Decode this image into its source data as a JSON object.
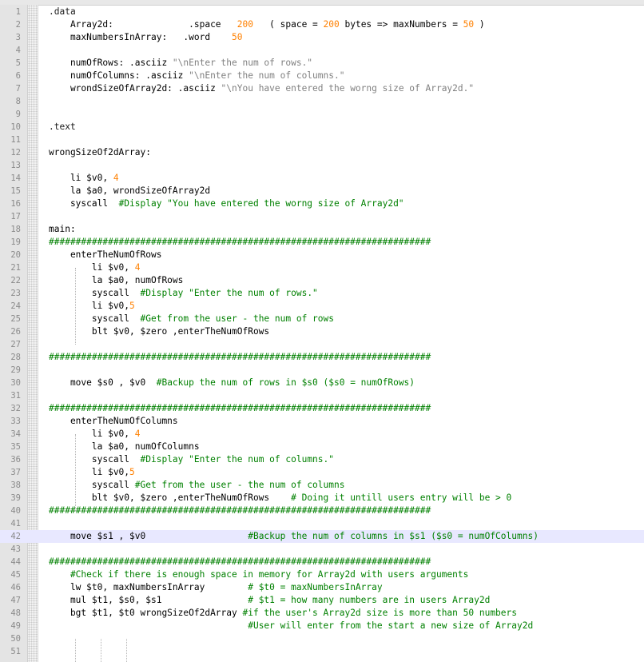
{
  "editor": {
    "line_numbers": [
      "1",
      "2",
      "3",
      "4",
      "5",
      "6",
      "7",
      "8",
      "9",
      "10",
      "11",
      "12",
      "13",
      "14",
      "15",
      "16",
      "17",
      "18",
      "19",
      "20",
      "21",
      "22",
      "23",
      "24",
      "25",
      "26",
      "27",
      "28",
      "29",
      "30",
      "31",
      "32",
      "33",
      "34",
      "35",
      "36",
      "37",
      "38",
      "39",
      "40",
      "41",
      "42",
      "43",
      "44",
      "45",
      "46",
      "47",
      "48",
      "49",
      "50",
      "51"
    ],
    "current_line": 42,
    "lines": [
      [
        {
          "t": ".data",
          "c": "dir"
        }
      ],
      [
        {
          "t": "    Array2d:              .space   ",
          "c": "kw"
        },
        {
          "t": "200",
          "c": "num"
        },
        {
          "t": "   ( space = ",
          "c": "kw"
        },
        {
          "t": "200",
          "c": "num"
        },
        {
          "t": " bytes => maxNumbers = ",
          "c": "kw"
        },
        {
          "t": "50",
          "c": "num"
        },
        {
          "t": " )",
          "c": "kw"
        }
      ],
      [
        {
          "t": "    maxNumbersInArray:   .word    ",
          "c": "kw"
        },
        {
          "t": "50",
          "c": "num"
        }
      ],
      [],
      [
        {
          "t": "    numOfRows: .asciiz ",
          "c": "kw"
        },
        {
          "t": "\"\\nEnter the num of rows.\"",
          "c": "str"
        }
      ],
      [
        {
          "t": "    numOfColumns: .asciiz ",
          "c": "kw"
        },
        {
          "t": "\"\\nEnter the num of columns.\"",
          "c": "str"
        }
      ],
      [
        {
          "t": "    wrondSizeOfArray2d: .asciiz ",
          "c": "kw"
        },
        {
          "t": "\"\\nYou have entered the worng size of Array2d.\"",
          "c": "str"
        }
      ],
      [],
      [],
      [
        {
          "t": ".text",
          "c": "dir"
        }
      ],
      [],
      [
        {
          "t": "wrongSizeOf2dArray:",
          "c": "kw"
        }
      ],
      [],
      [
        {
          "t": "    li $v0, ",
          "c": "kw"
        },
        {
          "t": "4",
          "c": "num"
        }
      ],
      [
        {
          "t": "    la $a0, wrondSizeOfArray2d",
          "c": "kw"
        }
      ],
      [
        {
          "t": "    syscall  ",
          "c": "kw"
        },
        {
          "t": "#Display \"You have entered the worng size of Array2d\"",
          "c": "com"
        }
      ],
      [],
      [
        {
          "t": "main:",
          "c": "kw"
        }
      ],
      [
        {
          "t": "#######################################################################",
          "c": "com"
        }
      ],
      [
        {
          "t": "    enterTheNumOfRows",
          "c": "kw"
        }
      ],
      [
        {
          "t": "        li $v0, ",
          "c": "kw"
        },
        {
          "t": "4",
          "c": "num"
        }
      ],
      [
        {
          "t": "        la $a0, numOfRows",
          "c": "kw"
        }
      ],
      [
        {
          "t": "        syscall  ",
          "c": "kw"
        },
        {
          "t": "#Display \"Enter the num of rows.\"",
          "c": "com"
        }
      ],
      [
        {
          "t": "        li $v0,",
          "c": "kw"
        },
        {
          "t": "5",
          "c": "num"
        }
      ],
      [
        {
          "t": "        syscall  ",
          "c": "kw"
        },
        {
          "t": "#Get from the user - the num of rows",
          "c": "com"
        }
      ],
      [
        {
          "t": "        blt $v0, $zero ,enterTheNumOfRows",
          "c": "kw"
        }
      ],
      [],
      [
        {
          "t": "#######################################################################",
          "c": "com"
        }
      ],
      [],
      [
        {
          "t": "    move $s0 , $v0  ",
          "c": "kw"
        },
        {
          "t": "#Backup the num of rows in $s0 ($s0 = numOfRows)",
          "c": "com"
        }
      ],
      [],
      [
        {
          "t": "#######################################################################",
          "c": "com"
        }
      ],
      [
        {
          "t": "    enterTheNumOfColumns",
          "c": "kw"
        }
      ],
      [
        {
          "t": "        li $v0, ",
          "c": "kw"
        },
        {
          "t": "4",
          "c": "num"
        }
      ],
      [
        {
          "t": "        la $a0, numOfColumns",
          "c": "kw"
        }
      ],
      [
        {
          "t": "        syscall  ",
          "c": "kw"
        },
        {
          "t": "#Display \"Enter the num of columns.\"",
          "c": "com"
        }
      ],
      [
        {
          "t": "        li $v0,",
          "c": "kw"
        },
        {
          "t": "5",
          "c": "num"
        }
      ],
      [
        {
          "t": "        syscall ",
          "c": "kw"
        },
        {
          "t": "#Get from the user - the num of columns",
          "c": "com"
        }
      ],
      [
        {
          "t": "        blt $v0, $zero ,enterTheNumOfRows    ",
          "c": "kw"
        },
        {
          "t": "# Doing it untill users entry will be > 0",
          "c": "com"
        }
      ],
      [
        {
          "t": "#######################################################################",
          "c": "com"
        }
      ],
      [],
      [
        {
          "t": "    move $s1 , $v0                   ",
          "c": "kw"
        },
        {
          "t": "#Backup the num of columns in $s1 ($s0 = numOfColumns)",
          "c": "com"
        }
      ],
      [],
      [
        {
          "t": "#######################################################################",
          "c": "com"
        }
      ],
      [
        {
          "t": "    #Check if there is enough space in memory for Array2d with users arguments",
          "c": "com"
        }
      ],
      [
        {
          "t": "    lw $t0, maxNumbersInArray        ",
          "c": "kw"
        },
        {
          "t": "# $t0 = maxNumbersInArray",
          "c": "com"
        }
      ],
      [
        {
          "t": "    mul $t1, $s0, $s1                ",
          "c": "kw"
        },
        {
          "t": "# $t1 = how many numbers are in users Array2d",
          "c": "com"
        }
      ],
      [
        {
          "t": "    bgt $t1, $t0 wrongSizeOf2dArray ",
          "c": "kw"
        },
        {
          "t": "#if the user's Array2d size is more than 50 numbers",
          "c": "com"
        }
      ],
      [
        {
          "t": "                                     ",
          "c": "kw"
        },
        {
          "t": "#User will enter from the start a new size of Array2d",
          "c": "com"
        }
      ],
      [],
      []
    ]
  }
}
